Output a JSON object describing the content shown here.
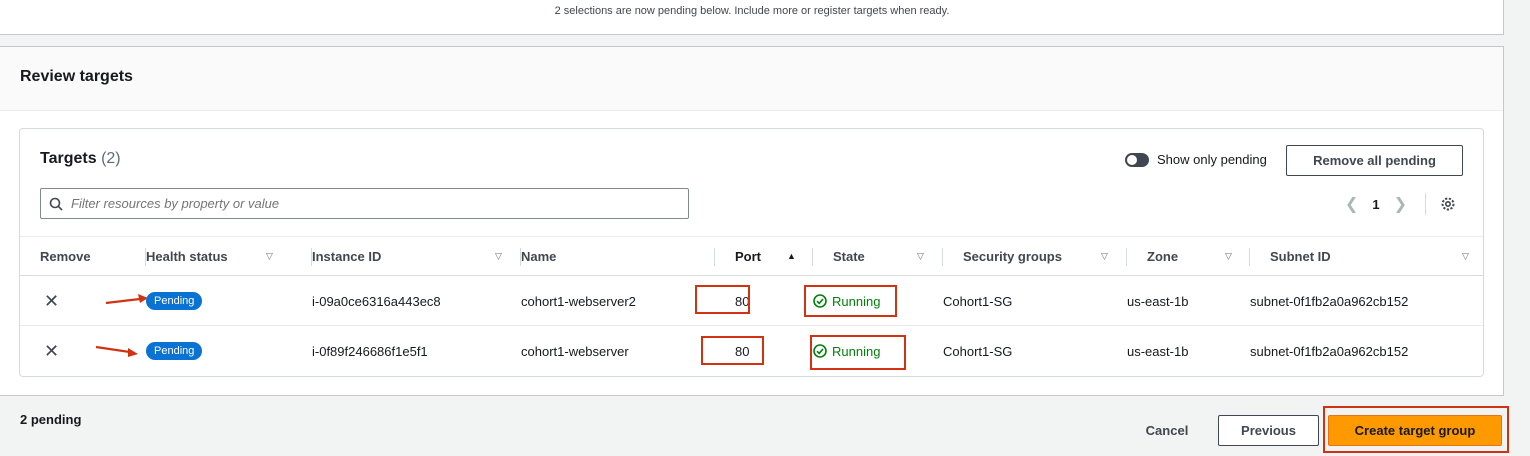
{
  "top": {
    "message": "2 selections are now pending below. Include more or register targets when ready."
  },
  "review": {
    "title": "Review targets"
  },
  "targets": {
    "title": "Targets",
    "count": "(2)",
    "show_only_pending": "Show only pending",
    "remove_all": "Remove all pending",
    "filter_placeholder": "Filter resources by property or value",
    "page": "1"
  },
  "columns": [
    "Remove",
    "Health status",
    "Instance ID",
    "Name",
    "Port",
    "State",
    "Security groups",
    "Zone",
    "Subnet ID"
  ],
  "rows": [
    {
      "health": "Pending",
      "instance_id": "i-09a0ce6316a443ec8",
      "name": "cohort1-webserver2",
      "port": "80",
      "state": "Running",
      "sg": "Cohort1-SG",
      "zone": "us-east-1b",
      "subnet": "subnet-0f1fb2a0a962cb152"
    },
    {
      "health": "Pending",
      "instance_id": "i-0f89f246686f1e5f1",
      "name": "cohort1-webserver",
      "port": "80",
      "state": "Running",
      "sg": "Cohort1-SG",
      "zone": "us-east-1b",
      "subnet": "subnet-0f1fb2a0a962cb152"
    }
  ],
  "footer": {
    "pending": "2 pending",
    "cancel": "Cancel",
    "previous": "Previous",
    "create": "Create target group"
  },
  "colors": {
    "primary": "#ff9900",
    "badge": "#0972d3",
    "running": "#037f0c",
    "highlight": "#d13212"
  },
  "icons": [
    "search-icon",
    "settings-icon",
    "chevron-left-icon",
    "chevron-right-icon",
    "close-icon",
    "check-circle-icon",
    "sort-up-icon",
    "sort-down-icon",
    "arrow-annotation-icon"
  ]
}
